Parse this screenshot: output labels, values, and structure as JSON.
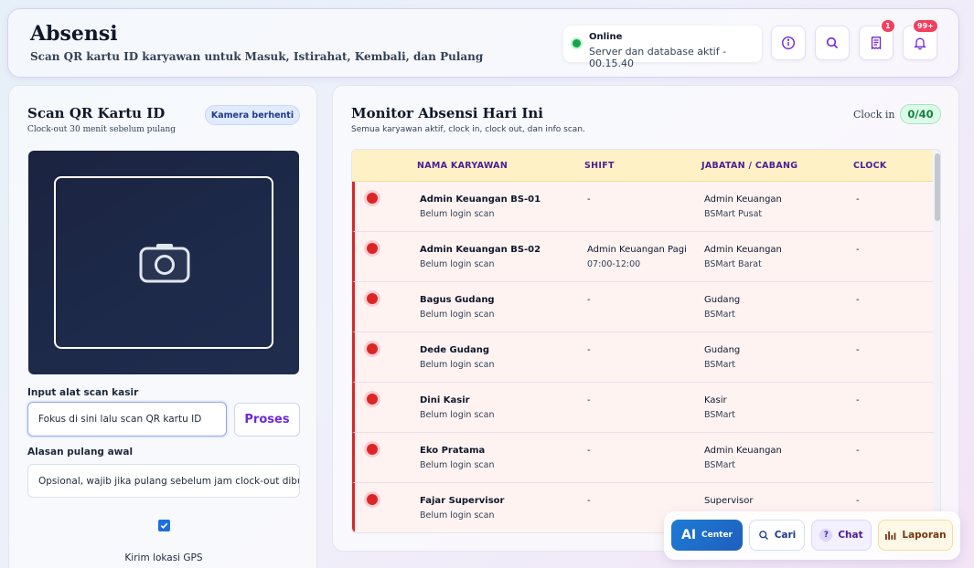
{
  "header": {
    "title": "Absensi",
    "subtitle": "Scan QR kartu ID karyawan untuk Masuk, Istirahat, Kembali, dan Pulang",
    "status": {
      "label": "Online",
      "text": "Server dan database aktif - 00.15.40",
      "color": "#16a34a"
    },
    "buttons": [
      {
        "icon": "info-icon"
      },
      {
        "icon": "search-icon"
      },
      {
        "icon": "receipt-icon",
        "badge": "1"
      },
      {
        "icon": "bell-icon",
        "badge": "99+"
      }
    ]
  },
  "scan_panel": {
    "title": "Scan QR Kartu ID",
    "subtitle": "Clock-out 30 menit sebelum pulang",
    "camera_status": "Kamera berhenti",
    "scanner_label": "Input alat scan kasir",
    "scanner_placeholder": "Fokus di sini lalu scan QR kartu ID",
    "process_button": "Proses",
    "reason_label": "Alasan pulang awal",
    "reason_placeholder": "Opsional, wajib jika pulang sebelum jam clock-out dibuka",
    "gps_checked": true,
    "gps_label": "Kirim lokasi GPS"
  },
  "monitor": {
    "title": "Monitor Absensi Hari Ini",
    "subtitle": "Semua karyawan aktif, clock in, clock out, dan info scan.",
    "clock_in_label": "Clock in",
    "clock_in_count": "0/40",
    "columns": [
      "NAMA KARYAWAN",
      "SHIFT",
      "JABATAN / CABANG",
      "CLOCK"
    ],
    "rows": [
      {
        "name": "Admin Keuangan BS-01",
        "status": "Belum login scan",
        "shift": "-",
        "shift_time": "",
        "role": "Admin Keuangan",
        "branch": "BSMart Pusat",
        "clock": "-"
      },
      {
        "name": "Admin Keuangan BS-02",
        "status": "Belum login scan",
        "shift": "Admin Keuangan Pagi",
        "shift_time": "07:00-12:00",
        "role": "Admin Keuangan",
        "branch": "BSMart Barat",
        "clock": "-"
      },
      {
        "name": "Bagus Gudang",
        "status": "Belum login scan",
        "shift": "-",
        "shift_time": "",
        "role": "Gudang",
        "branch": "BSMart",
        "clock": "-"
      },
      {
        "name": "Dede Gudang",
        "status": "Belum login scan",
        "shift": "-",
        "shift_time": "",
        "role": "Gudang",
        "branch": "BSMart",
        "clock": "-"
      },
      {
        "name": "Dini Kasir",
        "status": "Belum login scan",
        "shift": "-",
        "shift_time": "",
        "role": "Kasir",
        "branch": "BSMart",
        "clock": "-"
      },
      {
        "name": "Eko Pratama",
        "status": "Belum login scan",
        "shift": "-",
        "shift_time": "",
        "role": "Admin Keuangan",
        "branch": "BSMart",
        "clock": "-"
      },
      {
        "name": "Fajar Supervisor",
        "status": "Belum login scan",
        "shift": "-",
        "shift_time": "",
        "role": "Supervisor",
        "branch": "",
        "clock": "-"
      }
    ]
  },
  "dock": {
    "ai_mark": "AI",
    "ai_label": "Center",
    "search_label": "Cari",
    "chat_label": "Chat",
    "report_label": "Laporan"
  }
}
